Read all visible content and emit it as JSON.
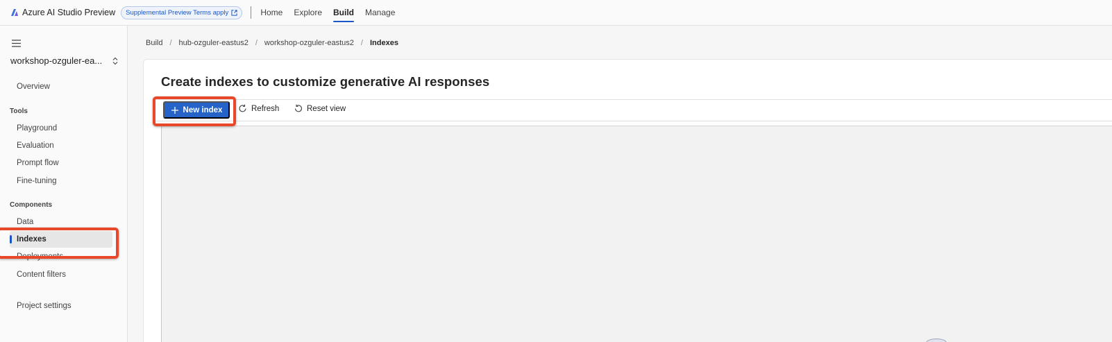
{
  "app": {
    "title": "Azure AI Studio Preview",
    "terms_badge": "Supplemental Preview Terms apply"
  },
  "topnav": {
    "items": [
      {
        "label": "Home"
      },
      {
        "label": "Explore"
      },
      {
        "label": "Build"
      },
      {
        "label": "Manage"
      }
    ],
    "active": "Build"
  },
  "sidebar": {
    "project_name": "workshop-ozguler-ea...",
    "overview": "Overview",
    "tools_heading": "Tools",
    "tools": [
      "Playground",
      "Evaluation",
      "Prompt flow",
      "Fine-tuning"
    ],
    "components_heading": "Components",
    "components": [
      "Data",
      "Indexes",
      "Deployments",
      "Content filters"
    ],
    "selected": "Indexes",
    "project_settings": "Project settings"
  },
  "breadcrumb": [
    "Build",
    "hub-ozguler-eastus2",
    "workshop-ozguler-eastus2",
    "Indexes"
  ],
  "main": {
    "title": "Create indexes to customize generative AI responses",
    "toolbar": {
      "new_index": "New index",
      "refresh": "Refresh",
      "reset_view": "Reset view"
    }
  },
  "colors": {
    "accent": "#2563c9",
    "highlight": "#e8472a"
  },
  "icons": [
    "azure-ai-logo-icon",
    "external-link-icon",
    "hamburger-icon",
    "chevron-up-down-icon",
    "plus-icon",
    "refresh-icon",
    "reset-icon"
  ]
}
